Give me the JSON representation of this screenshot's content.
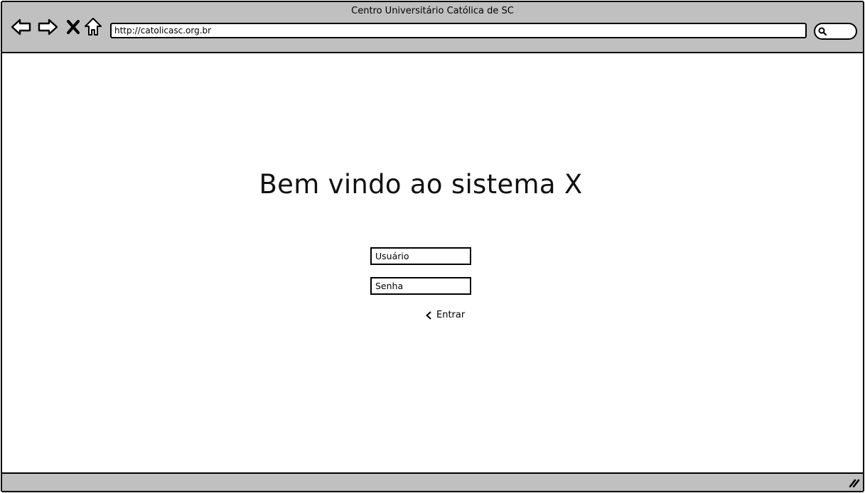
{
  "window": {
    "title": "Centro Universitário Católica de SC"
  },
  "toolbar": {
    "back_icon": "back-arrow-icon",
    "forward_icon": "forward-arrow-icon",
    "stop_icon": "close-icon",
    "home_icon": "home-icon",
    "address": "http://catolicasc.org.br",
    "search_icon": "search-icon"
  },
  "main": {
    "heading": "Bem vindo ao sistema X",
    "username_placeholder": "Usuário",
    "password_placeholder": "Senha",
    "submit_label": "Entrar",
    "submit_icon": "chevron-left-icon"
  },
  "statusbar": {
    "grip_icon": "resize-grip-icon"
  },
  "colors": {
    "chrome": "#c0c0c0",
    "border": "#000000",
    "background": "#ffffff"
  }
}
